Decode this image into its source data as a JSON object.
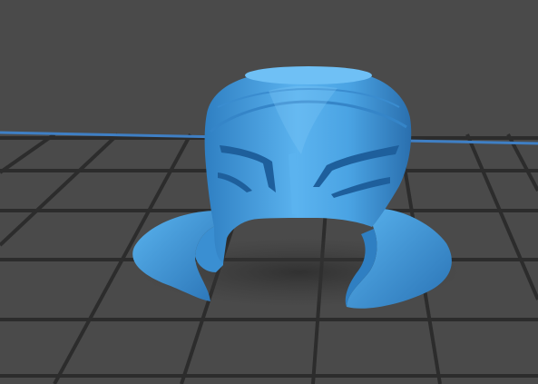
{
  "viewport": {
    "background_color": "#4a4a4a",
    "grid_color": "#2c2c2c",
    "bed_edge_color": "#3f7fc4",
    "model_color": "#4aa3e3",
    "model_highlight_color": "#7cc6f5",
    "model_shadow_color": "#2a73b5"
  },
  "model": {
    "icon": "helmet-icon"
  }
}
